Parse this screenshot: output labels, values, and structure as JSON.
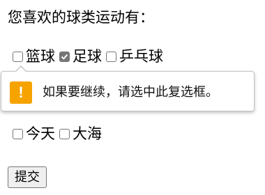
{
  "question": "您喜欢的球类运动有：",
  "options_row1": [
    {
      "label": "篮球",
      "checked": false
    },
    {
      "label": "足球",
      "checked": true
    },
    {
      "label": "乒乓球",
      "checked": false
    }
  ],
  "options_row2": [
    {
      "label": "今天",
      "checked": false
    },
    {
      "label": "大海",
      "checked": false
    }
  ],
  "validation": {
    "icon": "warning-icon",
    "icon_glyph": "!",
    "message": "如果要继续，请选中此复选框。",
    "icon_color": "#f6a300"
  },
  "submit_label": "提交"
}
